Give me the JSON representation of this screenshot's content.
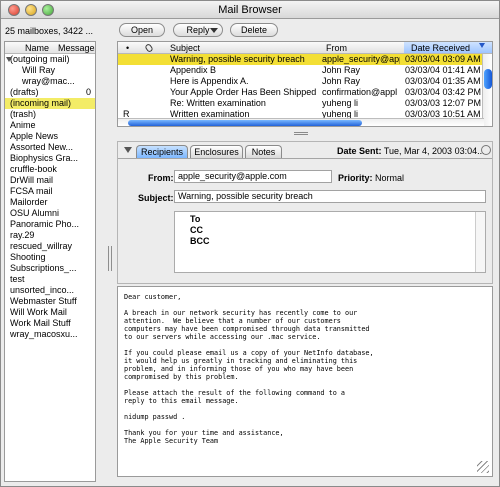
{
  "window": {
    "title": "Mail Browser"
  },
  "toolbar": {
    "mailbox_count": "25 mailboxes, 3422 ...",
    "open_label": "Open",
    "reply_label": "Reply",
    "delete_label": "Delete"
  },
  "sidebar": {
    "headers": {
      "name": "Name",
      "messages": "Messages"
    },
    "items": [
      {
        "label": "(outgoing mail)",
        "count": "",
        "indent": false,
        "selected": false,
        "expanded": true
      },
      {
        "label": "Will Ray",
        "count": "",
        "indent": true,
        "selected": false,
        "expanded": false
      },
      {
        "label": "wray@mac...",
        "count": "",
        "indent": true,
        "selected": false,
        "expanded": false
      },
      {
        "label": "(drafts)",
        "count": "0",
        "indent": false,
        "selected": false,
        "expanded": false
      },
      {
        "label": "(incoming mail)",
        "count": "",
        "indent": false,
        "selected": true,
        "expanded": false
      },
      {
        "label": "(trash)",
        "count": "",
        "indent": false,
        "selected": false,
        "expanded": false
      },
      {
        "label": "Anime",
        "count": "",
        "indent": false,
        "selected": false,
        "expanded": false
      },
      {
        "label": "Apple News",
        "count": "",
        "indent": false,
        "selected": false,
        "expanded": false
      },
      {
        "label": "Assorted New...",
        "count": "",
        "indent": false,
        "selected": false,
        "expanded": false
      },
      {
        "label": "Biophysics Gra...",
        "count": "",
        "indent": false,
        "selected": false,
        "expanded": false
      },
      {
        "label": "cruffle-book",
        "count": "",
        "indent": false,
        "selected": false,
        "expanded": false
      },
      {
        "label": "DrWill mail",
        "count": "",
        "indent": false,
        "selected": false,
        "expanded": false
      },
      {
        "label": "FCSA mail",
        "count": "",
        "indent": false,
        "selected": false,
        "expanded": false
      },
      {
        "label": "Mailorder",
        "count": "",
        "indent": false,
        "selected": false,
        "expanded": false
      },
      {
        "label": "OSU Alumni",
        "count": "",
        "indent": false,
        "selected": false,
        "expanded": false
      },
      {
        "label": "Panoramic Pho...",
        "count": "",
        "indent": false,
        "selected": false,
        "expanded": false
      },
      {
        "label": "ray.29",
        "count": "",
        "indent": false,
        "selected": false,
        "expanded": false
      },
      {
        "label": "rescued_willray",
        "count": "",
        "indent": false,
        "selected": false,
        "expanded": false
      },
      {
        "label": "Shooting",
        "count": "",
        "indent": false,
        "selected": false,
        "expanded": false
      },
      {
        "label": "Subscriptions_...",
        "count": "",
        "indent": false,
        "selected": false,
        "expanded": false
      },
      {
        "label": "test",
        "count": "",
        "indent": false,
        "selected": false,
        "expanded": false
      },
      {
        "label": "unsorted_inco...",
        "count": "",
        "indent": false,
        "selected": false,
        "expanded": false
      },
      {
        "label": "Webmaster Stuff",
        "count": "",
        "indent": false,
        "selected": false,
        "expanded": false
      },
      {
        "label": "Will Work Mail",
        "count": "",
        "indent": false,
        "selected": false,
        "expanded": false
      },
      {
        "label": "Work Mail Stuff",
        "count": "",
        "indent": false,
        "selected": false,
        "expanded": false
      },
      {
        "label": "wray_macosxu...",
        "count": "",
        "indent": false,
        "selected": false,
        "expanded": false
      }
    ]
  },
  "message_list": {
    "headers": {
      "flag": "•",
      "attachment": "📎",
      "subject": "Subject",
      "from": "From",
      "date_received": "Date Received"
    },
    "rows": [
      {
        "flag": "",
        "attachment": "",
        "subject": "Warning, possible security breach",
        "from": "apple_security@app",
        "date": "03/03/04 03:09 AM",
        "selected": true
      },
      {
        "flag": "",
        "attachment": "clip",
        "subject": "Appendix B",
        "from": "John Ray",
        "date": "03/03/04 01:41 AM",
        "selected": false
      },
      {
        "flag": "",
        "attachment": "clip",
        "subject": "Here is Appendix A.",
        "from": "John Ray",
        "date": "03/03/04 01:35 AM",
        "selected": false
      },
      {
        "flag": "",
        "attachment": "",
        "subject": "Your Apple Order Has Been Shipped",
        "from": "confirmation@appl",
        "date": "03/03/04 03:42 PM",
        "selected": false
      },
      {
        "flag": "",
        "attachment": "",
        "subject": "Re: Written examination",
        "from": "yuheng li",
        "date": "03/03/03 12:07 PM",
        "selected": false
      },
      {
        "flag": "R",
        "attachment": "",
        "subject": "Written examination",
        "from": "yuheng li",
        "date": "03/03/03 10:51 AM",
        "selected": false
      }
    ]
  },
  "info_panel": {
    "tabs": [
      {
        "label": "Recipients"
      },
      {
        "label": "Enclosures"
      },
      {
        "label": "Notes"
      }
    ],
    "date_sent_label": "Date Sent:",
    "date_sent_value": "Tue, Mar 4, 2003 03:04...",
    "from_label": "From:",
    "from_value": "apple_security@apple.com",
    "priority_label": "Priority:",
    "priority_value": "Normal",
    "subject_label": "Subject:",
    "subject_value": "Warning, possible security breach",
    "recipient_labels": {
      "to": "To",
      "cc": "CC",
      "bcc": "BCC"
    }
  },
  "message_body": {
    "text": "Dear customer,\n\nA breach in our network security has recently come to our\nattention.  We believe that a number of our customers\ncomputers may have been compromised through data transmitted\nto our servers while accessing our .mac service.\n\nIf you could please email us a copy of your NetInfo database,\nit would help us greatly in tracking and eliminating this\nproblem, and in informing those of you who may have been\ncompromised by this problem.\n\nPlease attach the result of the following command to a\nreply to this email message.\n\nnidump passwd .\n\nThank you for your time and assistance,\nThe Apple Security Team"
  }
}
